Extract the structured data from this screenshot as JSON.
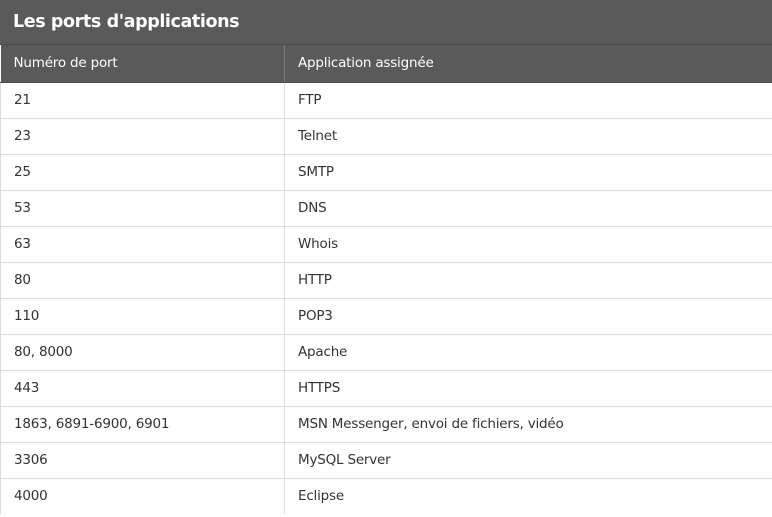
{
  "title": "Les ports d'applications",
  "columns": [
    "Numéro de port",
    "Application assignée"
  ],
  "rows": [
    {
      "port": "21",
      "app": "FTP"
    },
    {
      "port": "23",
      "app": "Telnet"
    },
    {
      "port": "25",
      "app": "SMTP"
    },
    {
      "port": "53",
      "app": "DNS"
    },
    {
      "port": "63",
      "app": "Whois"
    },
    {
      "port": "80",
      "app": "HTTP"
    },
    {
      "port": "110",
      "app": "POP3"
    },
    {
      "port": "80, 8000",
      "app": "Apache"
    },
    {
      "port": "443",
      "app": "HTTPS"
    },
    {
      "port": "1863, 6891-6900, 6901",
      "app": "MSN Messenger, envoi de fichiers, vidéo"
    },
    {
      "port": "3306",
      "app": "MySQL Server"
    },
    {
      "port": "4000",
      "app": "Eclipse"
    }
  ],
  "colors": {
    "header_bg": "#5a5a5a",
    "header_text": "#ffffff",
    "cell_text": "#333333",
    "grid": "#dcdcdc"
  }
}
